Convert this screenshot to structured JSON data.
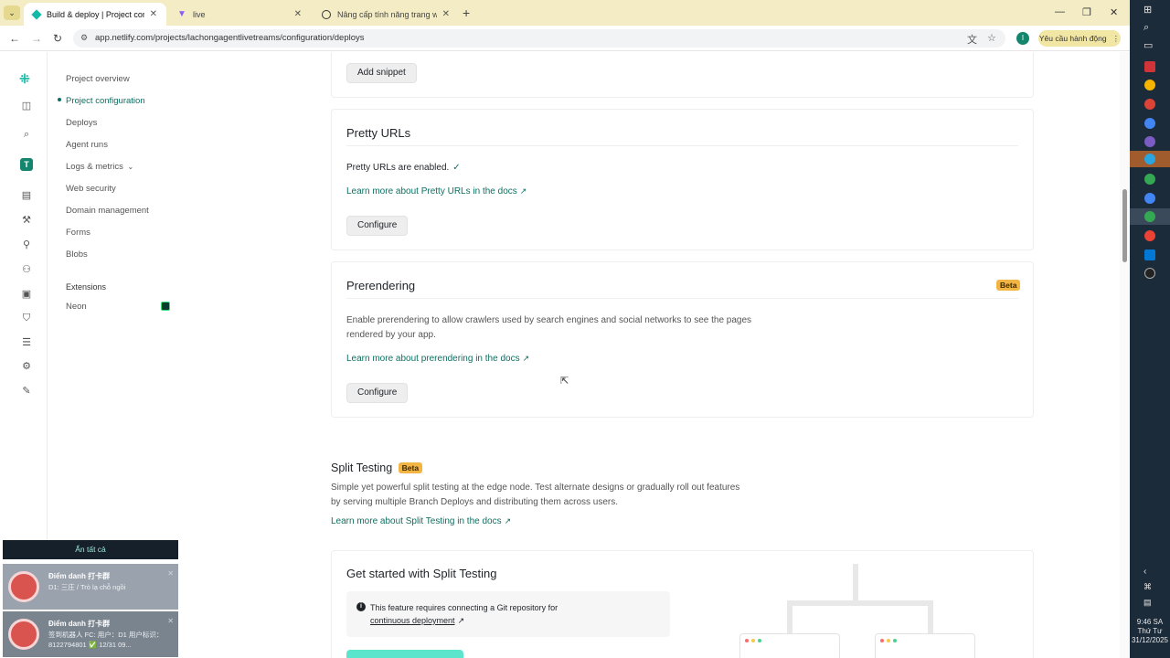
{
  "browser": {
    "tabs": [
      {
        "label": "Build & deploy | Project config",
        "active": true
      },
      {
        "label": "live",
        "active": false
      },
      {
        "label": "Nâng cấp tính năng trang web",
        "active": false
      }
    ],
    "new_tab": "+",
    "url": "app.netlify.com/projects/lachongagentlivetreams/configuration/deploys",
    "profile_initial": "I",
    "action_button": "Yêu cầu hành động"
  },
  "sidebar": {
    "items": [
      {
        "label": "Project overview"
      },
      {
        "label": "Project configuration",
        "active": true
      },
      {
        "label": "Deploys"
      },
      {
        "label": "Agent runs"
      },
      {
        "label": "Logs & metrics"
      },
      {
        "label": "Web security"
      },
      {
        "label": "Domain management"
      },
      {
        "label": "Forms"
      },
      {
        "label": "Blobs"
      }
    ],
    "extensions_heading": "Extensions",
    "extensions": [
      {
        "label": "Neon"
      }
    ],
    "rail_team_initial": "T"
  },
  "snippet": {
    "button": "Add snippet"
  },
  "pretty_urls": {
    "title": "Pretty URLs",
    "status": "Pretty URLs are enabled.",
    "check": "✓",
    "docs_link": "Learn more about Pretty URLs in the docs",
    "button": "Configure"
  },
  "prerendering": {
    "title": "Prerendering",
    "badge": "Beta",
    "description": "Enable prerendering to allow crawlers used by search engines and social networks to see the pages rendered by your app.",
    "docs_link": "Learn more about prerendering in the docs",
    "button": "Configure"
  },
  "split_testing": {
    "title": "Split Testing",
    "badge": "Beta",
    "description": "Simple yet powerful split testing at the edge node. Test alternate designs or gradually roll out features by serving multiple Branch Deploys and distributing them across users.",
    "docs_link": "Learn more about Split Testing in the docs",
    "card_title": "Get started with Split Testing",
    "info_text": "This feature requires connecting a Git repository for",
    "info_link": "continuous deployment"
  },
  "ext_arrow": "↗",
  "notifications": {
    "header": "Ẩn tất cả",
    "items": [
      {
        "title": "Điểm danh 打卡群",
        "body": "D1: 三庄 / Trò lạ chỗ ngồi"
      },
      {
        "title": "Điểm danh 打卡群",
        "body": "签到机器人 FC: 用户：D1 用户标识：8122794801 ✅ 12/31 09..."
      }
    ]
  },
  "clock": {
    "time": "9:46 SA",
    "day": "Thứ Tư",
    "date": "31/12/2025"
  }
}
